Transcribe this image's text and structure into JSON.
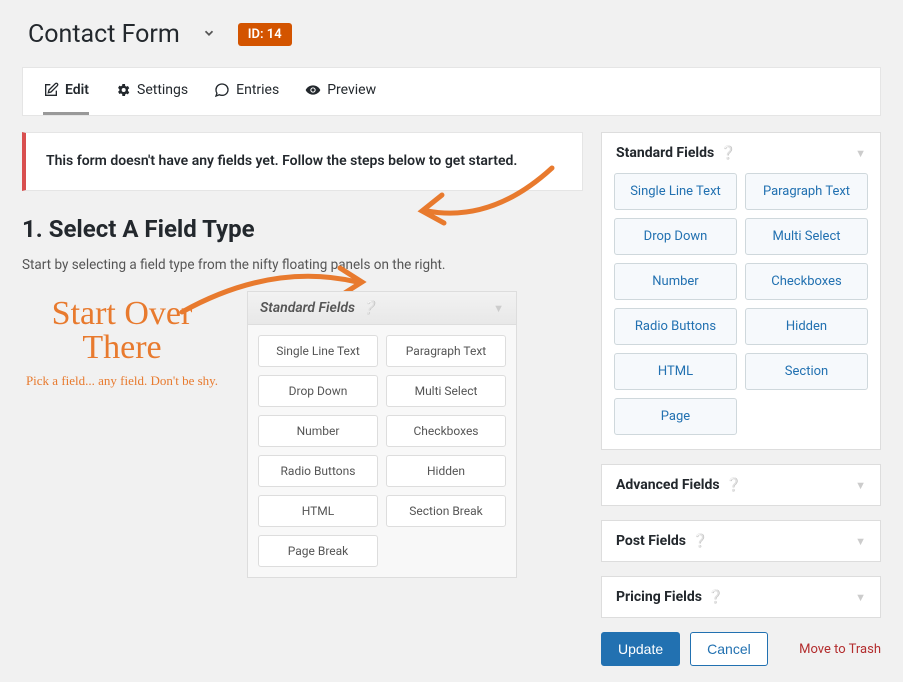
{
  "header": {
    "title": "Contact Form",
    "id_badge": "ID: 14"
  },
  "tabs": {
    "edit": "Edit",
    "settings": "Settings",
    "entries": "Entries",
    "preview": "Preview"
  },
  "notice": "This form doesn't have any fields yet. Follow the steps below to get started.",
  "step": {
    "heading": "1. Select A Field Type",
    "description": "Start by selecting a field type from the nifty floating panels on the right."
  },
  "handwriting": {
    "big": "Start Over There",
    "small": "Pick a field... any field. Don't be shy."
  },
  "preview_panel": {
    "title": "Standard Fields",
    "fields": [
      "Single Line Text",
      "Paragraph Text",
      "Drop Down",
      "Multi Select",
      "Number",
      "Checkboxes",
      "Radio Buttons",
      "Hidden",
      "HTML",
      "Section Break",
      "Page Break"
    ]
  },
  "right": {
    "standard": {
      "title": "Standard Fields",
      "fields": [
        "Single Line Text",
        "Paragraph Text",
        "Drop Down",
        "Multi Select",
        "Number",
        "Checkboxes",
        "Radio Buttons",
        "Hidden",
        "HTML",
        "Section",
        "Page"
      ]
    },
    "advanced": {
      "title": "Advanced Fields"
    },
    "post": {
      "title": "Post Fields"
    },
    "pricing": {
      "title": "Pricing Fields"
    }
  },
  "actions": {
    "update": "Update",
    "cancel": "Cancel",
    "trash": "Move to Trash"
  }
}
